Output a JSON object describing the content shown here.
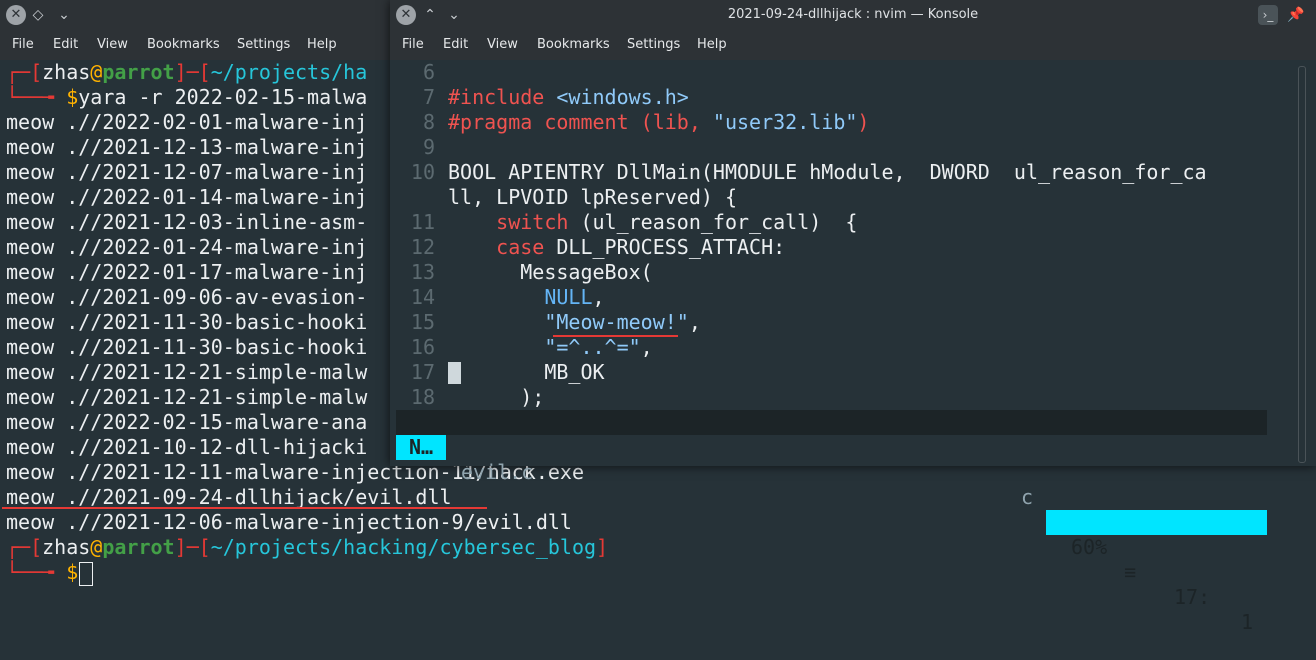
{
  "back_window": {
    "menu": [
      "File",
      "Edit",
      "View",
      "Bookmarks",
      "Settings",
      "Help"
    ],
    "prompt1": {
      "user": "zhas",
      "at": "@",
      "host": "parrot",
      "path": "~/projects/ha",
      "command": "yara -r 2022-02-15-malwa"
    },
    "results": [
      {
        "tag": "meow",
        "path": ".//2022-02-01-malware-inj"
      },
      {
        "tag": "meow",
        "path": ".//2021-12-13-malware-inj"
      },
      {
        "tag": "meow",
        "path": ".//2021-12-07-malware-inj"
      },
      {
        "tag": "meow",
        "path": ".//2022-01-14-malware-inj"
      },
      {
        "tag": "meow",
        "path": ".//2021-12-03-inline-asm-"
      },
      {
        "tag": "meow",
        "path": ".//2022-01-24-malware-inj"
      },
      {
        "tag": "meow",
        "path": ".//2022-01-17-malware-inj"
      },
      {
        "tag": "meow",
        "path": ".//2021-09-06-av-evasion-"
      },
      {
        "tag": "meow",
        "path": ".//2021-11-30-basic-hooki"
      },
      {
        "tag": "meow",
        "path": ".//2021-11-30-basic-hooki"
      },
      {
        "tag": "meow",
        "path": ".//2021-12-21-simple-malw"
      },
      {
        "tag": "meow",
        "path": ".//2021-12-21-simple-malw"
      },
      {
        "tag": "meow",
        "path": ".//2022-02-15-malware-ana"
      },
      {
        "tag": "meow",
        "path": ".//2021-10-12-dll-hijacki"
      },
      {
        "tag": "meow",
        "path": ".//2021-12-11-malware-injection-11/hack.exe"
      },
      {
        "tag": "meow",
        "path": ".//2021-09-24-dllhijack/evil.dll"
      },
      {
        "tag": "meow",
        "path": ".//2021-12-06-malware-injection-9/evil.dll"
      }
    ],
    "prompt2": {
      "user": "zhas",
      "at": "@",
      "host": "parrot",
      "path": "~/projects/hacking/cybersec_blog",
      "dollar": "$"
    }
  },
  "front_window": {
    "title": "2021-09-24-dllhijack : nvim — Konsole",
    "menu": [
      "File",
      "Edit",
      "View",
      "Bookmarks",
      "Settings",
      "Help"
    ],
    "code_lines": [
      {
        "num": "6",
        "segments": []
      },
      {
        "num": "7",
        "segments": [
          {
            "cls": "pre",
            "t": "#include "
          },
          {
            "cls": "str",
            "t": "<windows.h>"
          }
        ]
      },
      {
        "num": "8",
        "segments": [
          {
            "cls": "pre",
            "t": "#pragma comment (lib, "
          },
          {
            "cls": "str",
            "t": "\"user32.lib\""
          },
          {
            "cls": "pre",
            "t": ")"
          }
        ]
      },
      {
        "num": "9",
        "segments": []
      },
      {
        "num": "10",
        "segments": [
          {
            "cls": "type",
            "t": "BOOL APIENTRY DllMain(HMODULE hModule,  DWORD  ul_reason_for_ca"
          }
        ]
      },
      {
        "num": "",
        "segments": [
          {
            "cls": "type",
            "t": "ll, LPVOID lpReserved) {"
          }
        ]
      },
      {
        "num": "11",
        "segments": [
          {
            "cls": "type",
            "t": "    "
          },
          {
            "cls": "kw",
            "t": "switch"
          },
          {
            "cls": "type",
            "t": " (ul_reason_for_call)  {"
          }
        ]
      },
      {
        "num": "12",
        "segments": [
          {
            "cls": "type",
            "t": "    "
          },
          {
            "cls": "kw",
            "t": "case"
          },
          {
            "cls": "type",
            "t": " DLL_PROCESS_ATTACH:"
          }
        ]
      },
      {
        "num": "13",
        "segments": [
          {
            "cls": "type",
            "t": "      MessageBox("
          }
        ]
      },
      {
        "num": "14",
        "segments": [
          {
            "cls": "type",
            "t": "        "
          },
          {
            "cls": "const",
            "t": "NULL"
          },
          {
            "cls": "type",
            "t": ","
          }
        ]
      },
      {
        "num": "15",
        "segments": [
          {
            "cls": "type",
            "t": "        "
          },
          {
            "cls": "str",
            "t": "\"Meow-meow!\""
          },
          {
            "cls": "type",
            "t": ","
          }
        ]
      },
      {
        "num": "16",
        "segments": [
          {
            "cls": "type",
            "t": "        "
          },
          {
            "cls": "str",
            "t": "\"=^..^=\""
          },
          {
            "cls": "type",
            "t": ","
          }
        ]
      },
      {
        "num": "17",
        "segments": [
          {
            "cls": "type",
            "t": "        MB_OK"
          }
        ]
      },
      {
        "num": "18",
        "segments": [
          {
            "cls": "type",
            "t": "      );"
          }
        ]
      }
    ],
    "status": {
      "mode": "N…",
      "file": "evil.c",
      "filetype": "c",
      "percent": "60%",
      "sep": "≡",
      "line": "17:",
      "col": "1"
    }
  },
  "colors": {
    "background": "#263238",
    "prompt_red": "#e53935",
    "host_green": "#43a047",
    "dollar_orange": "#ffb300",
    "path_cyan": "#26c6da",
    "status_accent": "#00e5ff"
  }
}
